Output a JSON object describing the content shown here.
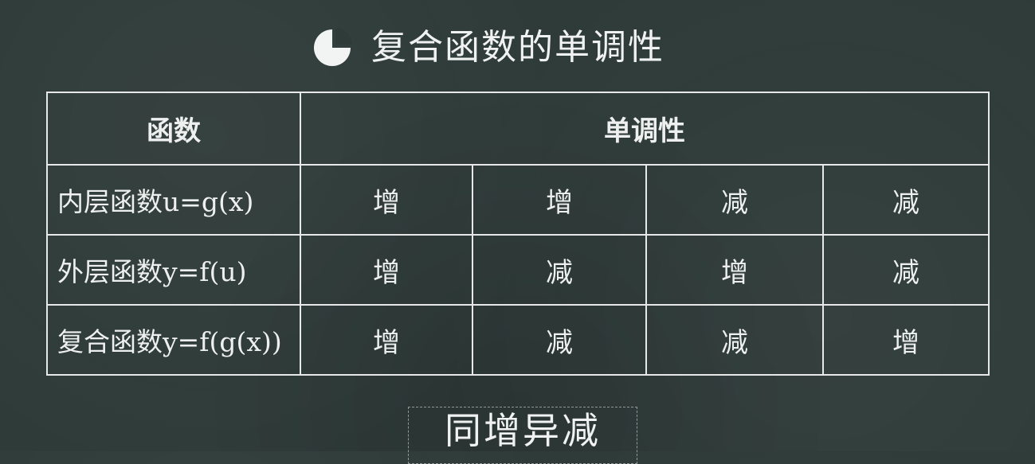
{
  "title": {
    "icon": "pie-chart-icon",
    "text": "复合函数的单调性"
  },
  "table": {
    "headers": {
      "function": "函数",
      "monotonicity": "单调性"
    },
    "rows": [
      {
        "label": "内层函数u=g(x)",
        "cells": [
          "增",
          "增",
          "减",
          "减"
        ]
      },
      {
        "label": "外层函数y=f(u)",
        "cells": [
          "增",
          "减",
          "增",
          "减"
        ]
      },
      {
        "label": "复合函数y=f(g(x))",
        "cells": [
          "增",
          "减",
          "减",
          "增"
        ]
      }
    ]
  },
  "rule": "同增异减",
  "colors": {
    "background": "#2f3b39",
    "chalk": "#eef0ef"
  }
}
